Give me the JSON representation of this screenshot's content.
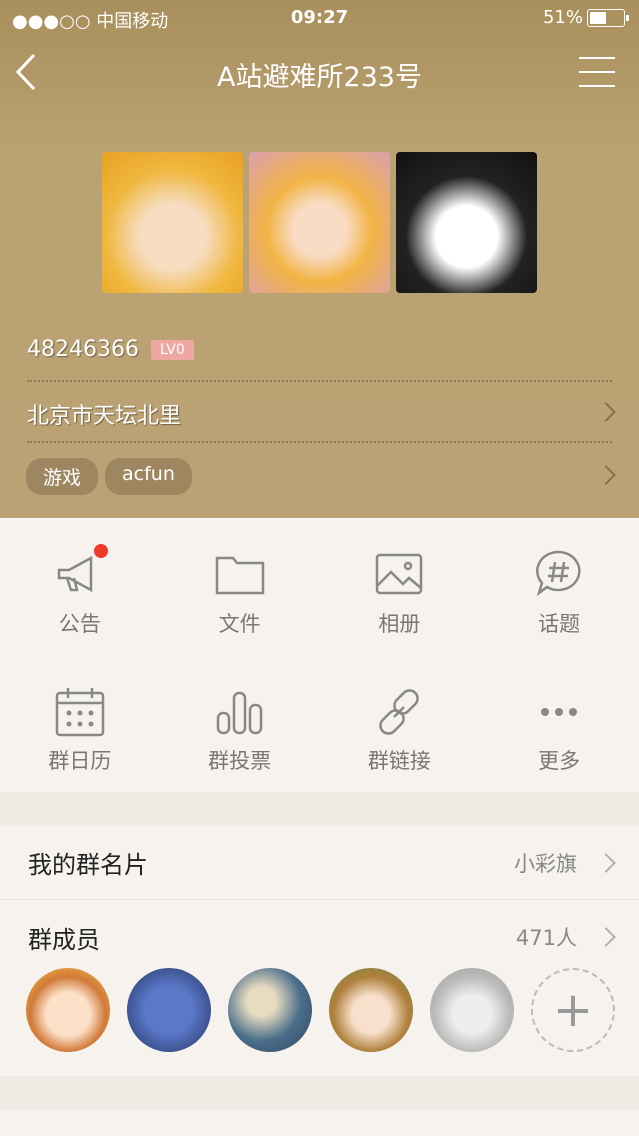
{
  "status": {
    "carrier": "●●●○○ 中国移动",
    "time": "09:27",
    "battery": "51%"
  },
  "nav": {
    "title": "A站避难所233号"
  },
  "group": {
    "id": "48246366",
    "level": "LV0",
    "location": "北京市天坛北里",
    "tags": [
      "游戏",
      "acfun"
    ]
  },
  "features": [
    {
      "label": "公告",
      "icon": "megaphone-icon"
    },
    {
      "label": "文件",
      "icon": "folder-icon"
    },
    {
      "label": "相册",
      "icon": "photo-icon"
    },
    {
      "label": "话题",
      "icon": "hashtag-icon"
    },
    {
      "label": "群日历",
      "icon": "calendar-icon"
    },
    {
      "label": "群投票",
      "icon": "bar-chart-icon"
    },
    {
      "label": "群链接",
      "icon": "link-icon"
    },
    {
      "label": "更多",
      "icon": "more-icon"
    }
  ],
  "card": {
    "label": "我的群名片",
    "value": "小彩旗"
  },
  "members": {
    "label": "群成员",
    "count": "471人"
  },
  "colors": {
    "header": "#bba274",
    "badge": "#eea8a2",
    "dot": "#f0392b"
  }
}
